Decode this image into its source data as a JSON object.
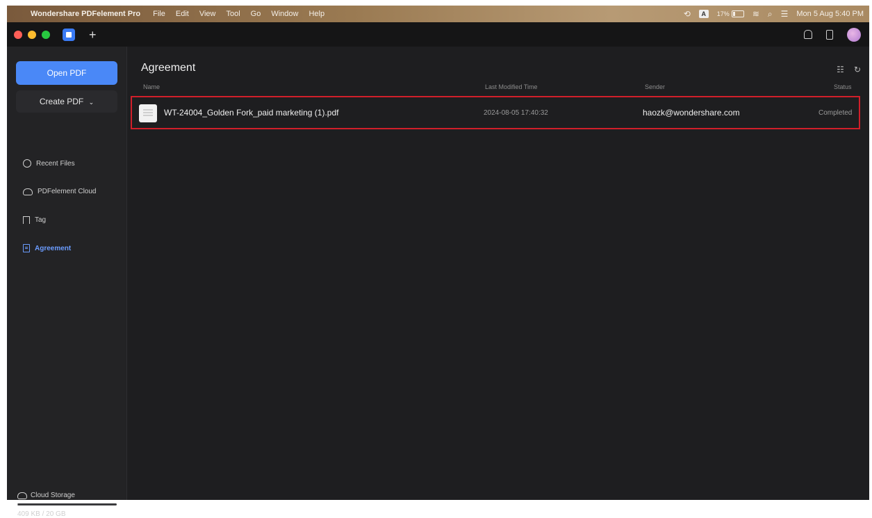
{
  "menubar": {
    "app_name": "Wondershare PDFelement Pro",
    "menus": [
      "File",
      "Edit",
      "View",
      "Tool",
      "Go",
      "Window",
      "Help"
    ],
    "battery": "17%",
    "datetime": "Mon 5 Aug  5:40 PM",
    "input_source": "A"
  },
  "sidebar": {
    "open_pdf": "Open PDF",
    "create_pdf": "Create PDF",
    "items": [
      {
        "label": "Recent Files",
        "icon": "clock-icon"
      },
      {
        "label": "PDFelement Cloud",
        "icon": "cloud-icon"
      },
      {
        "label": "Tag",
        "icon": "tag-icon"
      },
      {
        "label": "Agreement",
        "icon": "document-icon",
        "active": true
      }
    ],
    "cloud_storage_label": "Cloud Storage",
    "storage_used": "409 KB / 20 GB",
    "storage_fraction": 2e-05
  },
  "main": {
    "title": "Agreement",
    "columns": {
      "name": "Name",
      "last_modified": "Last Modified Time",
      "sender": "Sender",
      "status": "Status"
    },
    "rows": [
      {
        "name": "WT-24004_Golden Fork_paid marketing (1).pdf",
        "last_modified": "2024-08-05 17:40:32",
        "sender": "haozk@wondershare.com",
        "status": "Completed"
      }
    ]
  },
  "colors": {
    "accent": "#4a88f7",
    "active_nav": "#6b9cff",
    "highlight_border": "#d11f2a",
    "background": "#1e1e20"
  }
}
